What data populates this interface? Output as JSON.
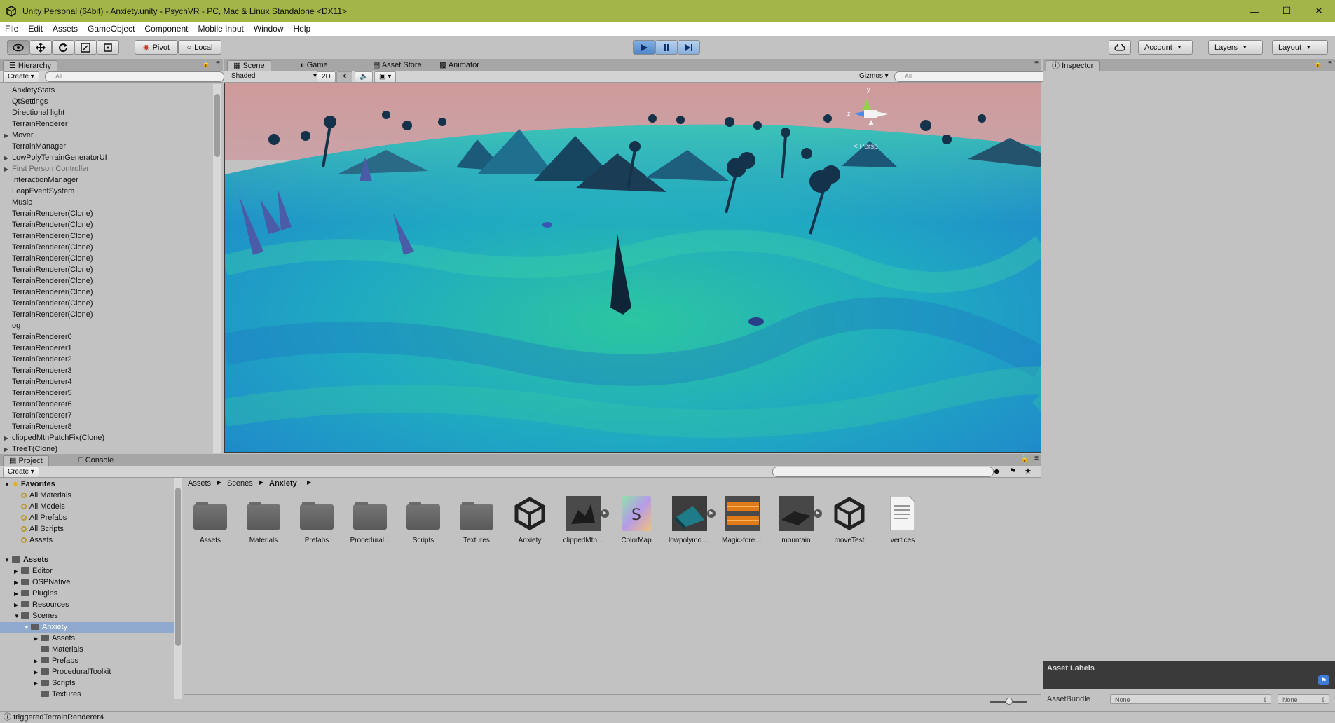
{
  "window": {
    "title": "Unity Personal (64bit) - Anxiety.unity - PsychVR - PC, Mac & Linux Standalone <DX11>",
    "minimize": "—",
    "maximize": "☐",
    "close": "✕"
  },
  "menu": [
    "File",
    "Edit",
    "Assets",
    "GameObject",
    "Component",
    "Mobile Input",
    "Window",
    "Help"
  ],
  "toolbar": {
    "pivot": "Pivot",
    "local": "Local",
    "account": "Account",
    "layers": "Layers",
    "layout": "Layout"
  },
  "hierarchy": {
    "tab": "Hierarchy",
    "create": "Create",
    "search_placeholder": "All",
    "items": [
      {
        "label": "AnxietyStats",
        "expandable": false,
        "dim": false
      },
      {
        "label": "QtSettings",
        "expandable": false,
        "dim": false
      },
      {
        "label": "Directional light",
        "expandable": false,
        "dim": false
      },
      {
        "label": "TerrainRenderer",
        "expandable": false,
        "dim": false
      },
      {
        "label": "Mover",
        "expandable": true,
        "dim": false
      },
      {
        "label": "TerrainManager",
        "expandable": false,
        "dim": false
      },
      {
        "label": "LowPolyTerrainGeneratorUI",
        "expandable": true,
        "dim": false
      },
      {
        "label": "First Person Controller",
        "expandable": true,
        "dim": true
      },
      {
        "label": "InteractionManager",
        "expandable": false,
        "dim": false
      },
      {
        "label": "LeapEventSystem",
        "expandable": false,
        "dim": false
      },
      {
        "label": "Music",
        "expandable": false,
        "dim": false
      },
      {
        "label": "TerrainRenderer(Clone)",
        "expandable": false,
        "dim": false
      },
      {
        "label": "TerrainRenderer(Clone)",
        "expandable": false,
        "dim": false
      },
      {
        "label": "TerrainRenderer(Clone)",
        "expandable": false,
        "dim": false
      },
      {
        "label": "TerrainRenderer(Clone)",
        "expandable": false,
        "dim": false
      },
      {
        "label": "TerrainRenderer(Clone)",
        "expandable": false,
        "dim": false
      },
      {
        "label": "TerrainRenderer(Clone)",
        "expandable": false,
        "dim": false
      },
      {
        "label": "TerrainRenderer(Clone)",
        "expandable": false,
        "dim": false
      },
      {
        "label": "TerrainRenderer(Clone)",
        "expandable": false,
        "dim": false
      },
      {
        "label": "TerrainRenderer(Clone)",
        "expandable": false,
        "dim": false
      },
      {
        "label": "TerrainRenderer(Clone)",
        "expandable": false,
        "dim": false
      },
      {
        "label": "og",
        "expandable": false,
        "dim": false
      },
      {
        "label": "TerrainRenderer0",
        "expandable": false,
        "dim": false
      },
      {
        "label": "TerrainRenderer1",
        "expandable": false,
        "dim": false
      },
      {
        "label": "TerrainRenderer2",
        "expandable": false,
        "dim": false
      },
      {
        "label": "TerrainRenderer3",
        "expandable": false,
        "dim": false
      },
      {
        "label": "TerrainRenderer4",
        "expandable": false,
        "dim": false
      },
      {
        "label": "TerrainRenderer5",
        "expandable": false,
        "dim": false
      },
      {
        "label": "TerrainRenderer6",
        "expandable": false,
        "dim": false
      },
      {
        "label": "TerrainRenderer7",
        "expandable": false,
        "dim": false
      },
      {
        "label": "TerrainRenderer8",
        "expandable": false,
        "dim": false
      },
      {
        "label": "clippedMtnPatchFix(Clone)",
        "expandable": true,
        "dim": false
      },
      {
        "label": "TreeT(Clone)",
        "expandable": true,
        "dim": false
      }
    ]
  },
  "scene": {
    "tabs": [
      "Scene",
      "Game",
      "Asset Store",
      "Animator"
    ],
    "shading": "Shaded",
    "mode_2d": "2D",
    "gizmos": "Gizmos",
    "search_placeholder": "All",
    "persp_label": "< Persp",
    "axis_y": "y",
    "axis_z": "z"
  },
  "inspector": {
    "tab": "Inspector",
    "asset_labels": "Asset Labels",
    "asset_bundle_label": "AssetBundle",
    "bundle_value": "None",
    "variant_value": "None"
  },
  "project": {
    "tabs": [
      "Project",
      "Console"
    ],
    "create": "Create",
    "breadcrumb": [
      "Assets",
      "Scenes",
      "Anxiety"
    ],
    "favorites_label": "Favorites",
    "favorites": [
      "All Materials",
      "All Models",
      "All Prefabs",
      "All Scripts",
      "Assets"
    ],
    "assets_label": "Assets",
    "tree": [
      {
        "label": "Editor",
        "depth": 1,
        "arrow": "right"
      },
      {
        "label": "OSPNative",
        "depth": 1,
        "arrow": "right"
      },
      {
        "label": "Plugins",
        "depth": 1,
        "arrow": "right"
      },
      {
        "label": "Resources",
        "depth": 1,
        "arrow": "right"
      },
      {
        "label": "Scenes",
        "depth": 1,
        "arrow": "down"
      },
      {
        "label": "Anxiety",
        "depth": 2,
        "arrow": "down",
        "selected": true
      },
      {
        "label": "Assets",
        "depth": 3,
        "arrow": "right"
      },
      {
        "label": "Materials",
        "depth": 3,
        "arrow": ""
      },
      {
        "label": "Prefabs",
        "depth": 3,
        "arrow": "right"
      },
      {
        "label": "ProceduralToolkit",
        "depth": 3,
        "arrow": "right"
      },
      {
        "label": "Scripts",
        "depth": 3,
        "arrow": "right"
      },
      {
        "label": "Textures",
        "depth": 3,
        "arrow": ""
      }
    ],
    "assets": [
      {
        "label": "Assets",
        "kind": "folder"
      },
      {
        "label": "Materials",
        "kind": "folder"
      },
      {
        "label": "Prefabs",
        "kind": "folder"
      },
      {
        "label": "Procedural...",
        "kind": "folder"
      },
      {
        "label": "Scripts",
        "kind": "folder"
      },
      {
        "label": "Textures",
        "kind": "folder"
      },
      {
        "label": "Anxiety",
        "kind": "unity"
      },
      {
        "label": "clippedMtn...",
        "kind": "mesh-dark"
      },
      {
        "label": "ColorMap",
        "kind": "colormap"
      },
      {
        "label": "lowpolymou...",
        "kind": "mesh-teal"
      },
      {
        "label": "Magic-fores...",
        "kind": "audio"
      },
      {
        "label": "mountain",
        "kind": "mesh-terrain"
      },
      {
        "label": "moveTest",
        "kind": "unity"
      },
      {
        "label": "vertices",
        "kind": "text"
      }
    ]
  },
  "status": {
    "message": "triggeredTerrainRenderer4"
  },
  "colors": {
    "titlebar": "#a3b449",
    "sky": "#cf9a9a",
    "terrain_a": "#1f8fc9",
    "terrain_b": "#2cc6a0",
    "play_blue": "#4f86c8"
  }
}
